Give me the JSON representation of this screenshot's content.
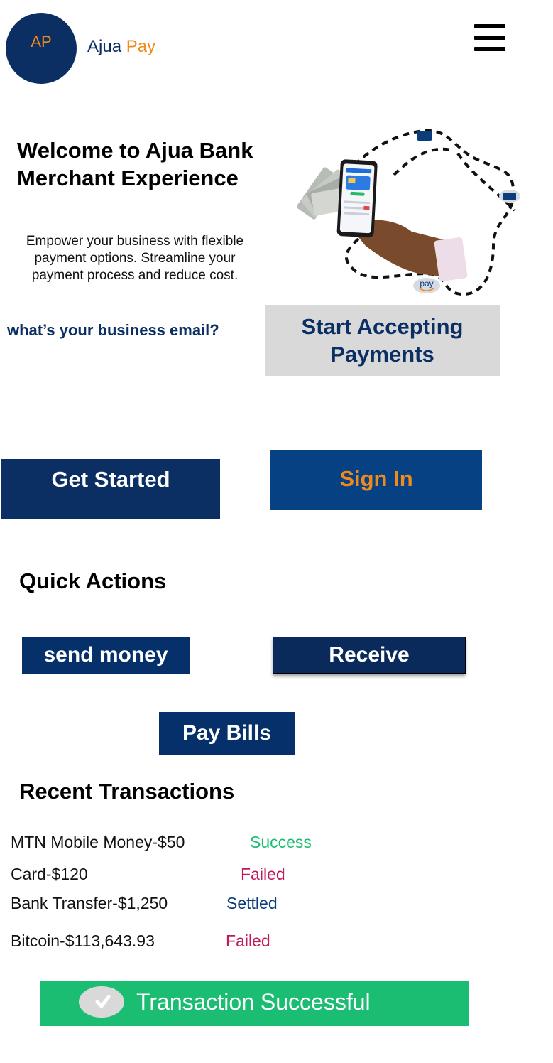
{
  "header": {
    "logo_initials": "AP",
    "brand_name": "Ajua",
    "brand_accent": "Pay"
  },
  "hero": {
    "title": "Welcome to Ajua Bank Merchant Experience",
    "description": "Empower your business with flexible payment options. Streamline your payment process and reduce cost.",
    "illustration_badge": "pay"
  },
  "email": {
    "placeholder": "what’s your business email?"
  },
  "buttons": {
    "start_accepting": "Start Accepting Payments",
    "get_started": "Get Started",
    "sign_in": "Sign In"
  },
  "quick_actions": {
    "title": "Quick Actions",
    "send_money": "send money",
    "receive": "Receive",
    "pay_bills": "Pay Bills"
  },
  "recent_transactions": {
    "title": "Recent Transactions",
    "items": [
      {
        "description": "MTN Mobile Money-$50",
        "status": "Success"
      },
      {
        "description": "Card-$120",
        "status": "Failed"
      },
      {
        "description": "Bank Transfer-$1,250",
        "status": "Settled"
      },
      {
        "description": "Bitcoin-$113,643.93",
        "status": "Failed"
      }
    ]
  },
  "toast": {
    "message": "Transaction Successful",
    "icon": "check-icon"
  },
  "colors": {
    "navy": "#0b2f63",
    "orange": "#f08a1c",
    "success": "#1bbd72",
    "failed": "#c0195a",
    "settled": "#0b3d7a"
  }
}
